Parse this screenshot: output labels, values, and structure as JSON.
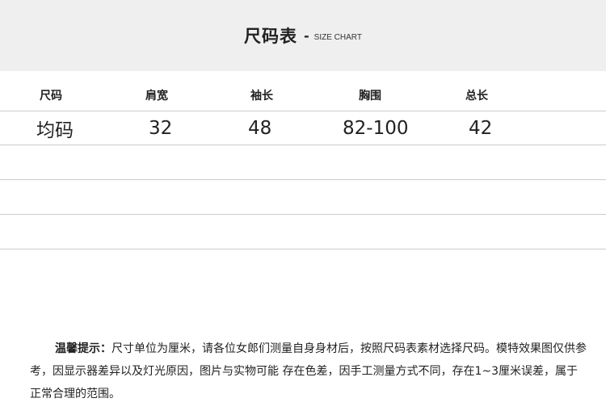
{
  "header": {
    "title": "尺码表",
    "dash": "-",
    "subtitle": "SIZE CHART"
  },
  "table": {
    "columns": [
      "尺码",
      "肩宽",
      "袖长",
      "胸围",
      "总长"
    ],
    "rows": [
      [
        "均码",
        "32",
        "48",
        "82-100",
        "42"
      ]
    ]
  },
  "notes": {
    "label": "温馨提示：",
    "text": "尺寸单位为厘米，请各位女郎们测量自身身材后，按照尺码表素材选择尺码。模特效果图仅供参考，因显示器差异以及灯光原因，图片与实物可能 存在色差，因手工测量方式不同，存在1~3厘米误差，属于正常合理的范围。"
  },
  "colors": {
    "header_band": "#efefef",
    "divider": "#cccccc",
    "text": "#222222"
  }
}
